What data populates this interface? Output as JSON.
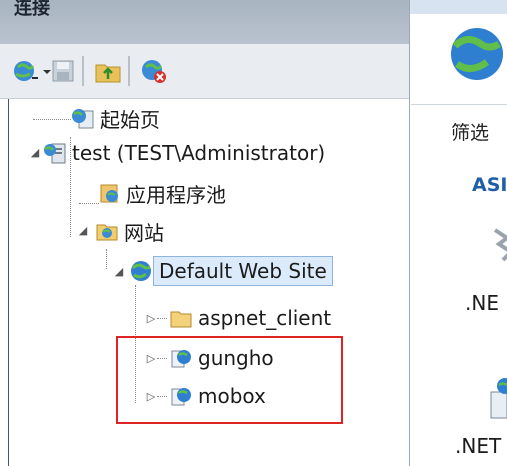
{
  "connections_pane": {
    "title": "连接",
    "toolbar": [
      {
        "icon": "globe-connect-icon"
      },
      {
        "icon": "save-icon"
      },
      {
        "icon": "folder-up-icon"
      },
      {
        "icon": "disconnect-icon"
      }
    ]
  },
  "tree": {
    "start_page": "起始页",
    "server": "test (TEST\\Administrator)",
    "app_pools": "应用程序池",
    "sites": "网站",
    "default_site": "Default Web Site",
    "children": [
      "aspnet_client",
      "gungho",
      "mobox"
    ]
  },
  "main_pane": {
    "filter_label": "筛选",
    "group_header": "ASI",
    "feature_1": ".NE",
    "feature_2": ".NET"
  },
  "colors": {
    "header_bg": "#b0bbc7",
    "selection": "#dcebfb",
    "highlight_box": "#e02424",
    "link_blue": "#1f5fa8"
  }
}
